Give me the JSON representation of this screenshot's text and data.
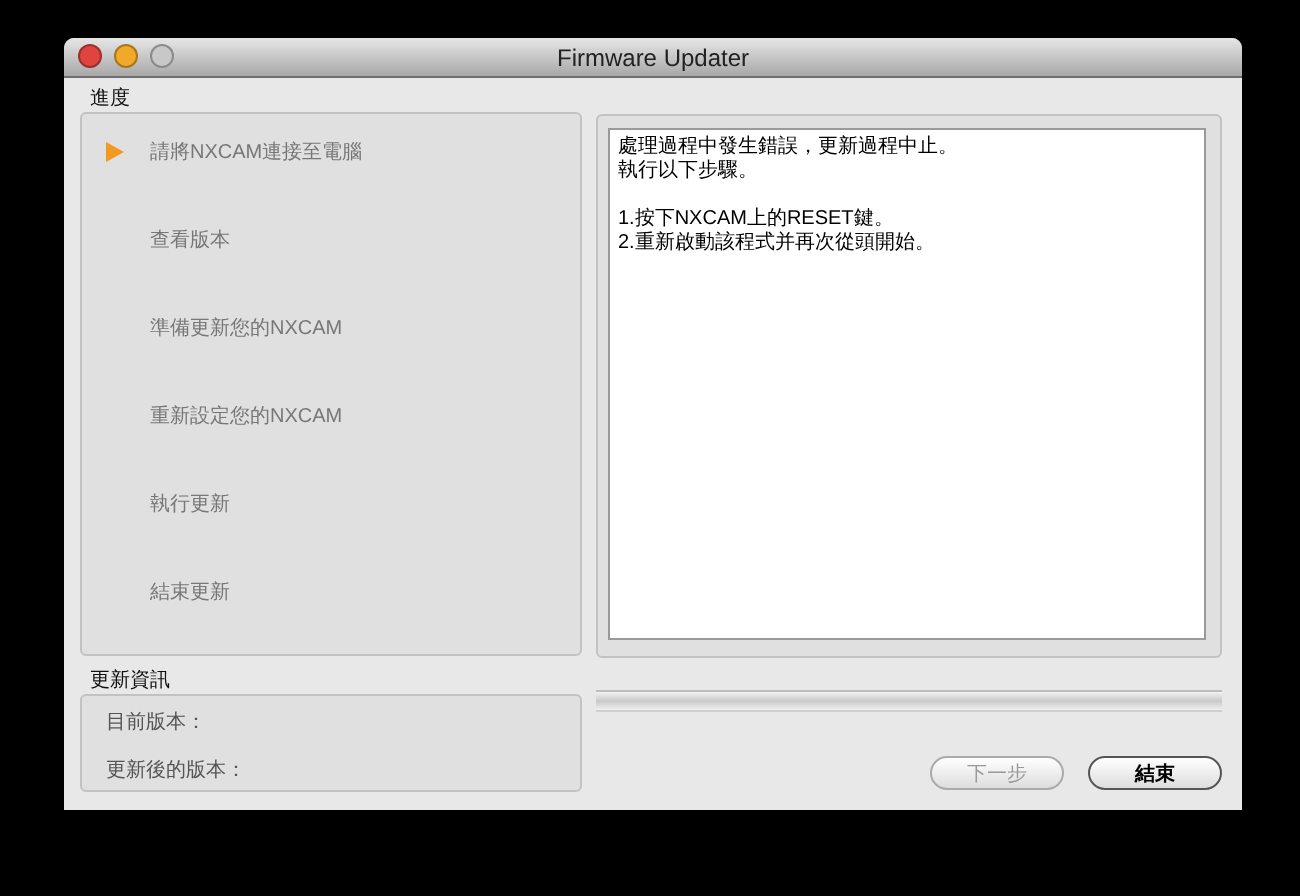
{
  "window": {
    "title": "Firmware Updater"
  },
  "progress_section": {
    "label": "進度",
    "steps": [
      {
        "label": "請將NXCAM連接至電腦",
        "selected": true
      },
      {
        "label": "查看版本",
        "selected": false
      },
      {
        "label": "準備更新您的NXCAM",
        "selected": false
      },
      {
        "label": "重新設定您的NXCAM",
        "selected": false
      },
      {
        "label": "執行更新",
        "selected": false
      },
      {
        "label": "結束更新",
        "selected": false
      }
    ]
  },
  "message": {
    "paragraphs": [
      [
        "處理過程中發生錯誤，更新過程中止。",
        "執行以下步驟。"
      ],
      [
        "1.按下NXCAM上的RESET鍵。",
        "2.重新啟動該程式并再次從頭開始。"
      ]
    ]
  },
  "update_info": {
    "label": "更新資訊",
    "fields": [
      {
        "label": "目前版本："
      },
      {
        "label": "更新後的版本："
      }
    ]
  },
  "progress": {
    "level": 0
  },
  "buttons": [
    {
      "label": "下一步",
      "disabled": true
    },
    {
      "label": "結束",
      "disabled": false
    }
  ]
}
